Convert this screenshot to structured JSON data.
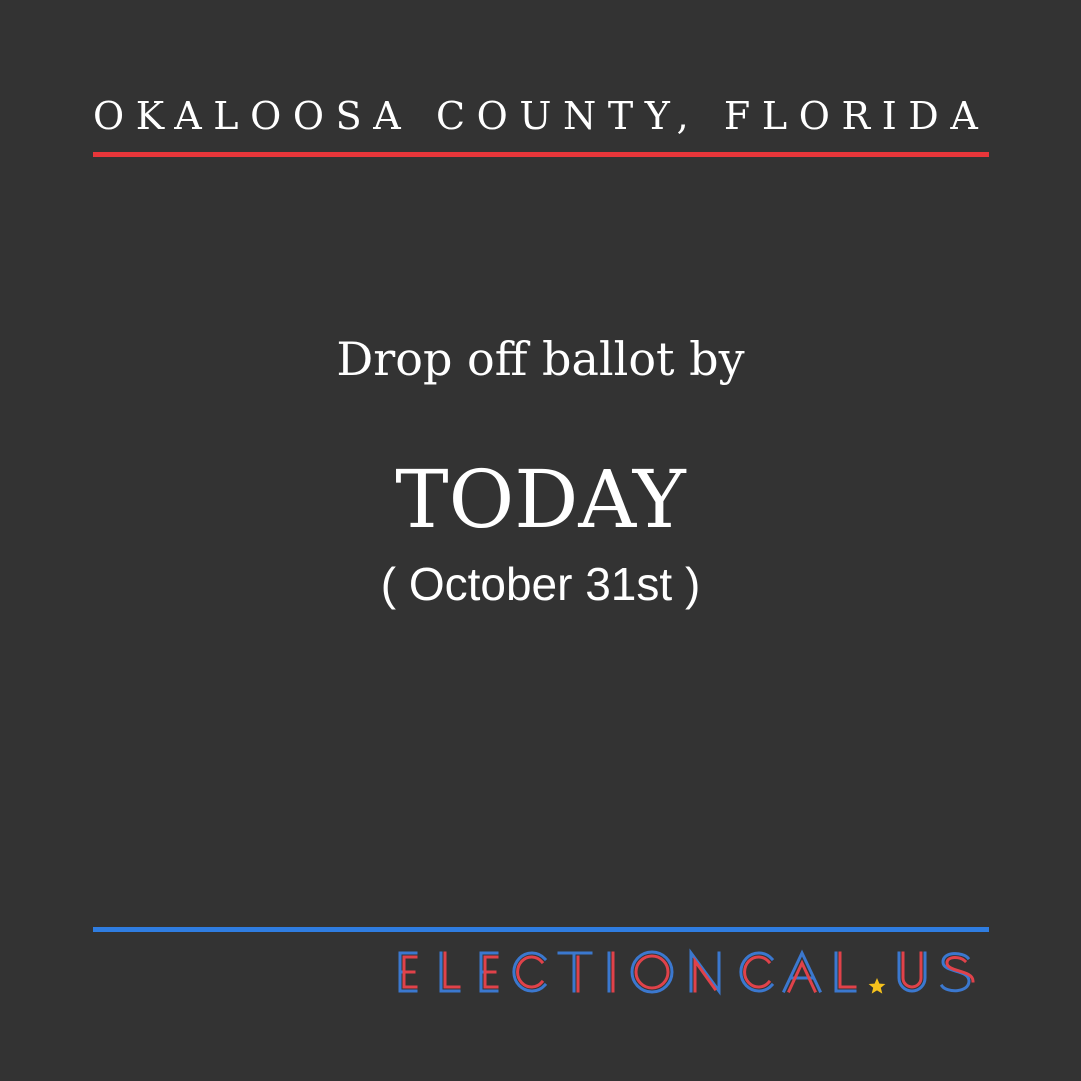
{
  "header": {
    "county": "OKALOOSA COUNTY, FLORIDA"
  },
  "message": {
    "lead": "Drop off ballot by",
    "deadline": "TODAY",
    "date": "( October 31st )"
  },
  "brand": {
    "logo_text": "ELECTIONCAL.US"
  },
  "colors": {
    "background": "#333333",
    "text": "#ffffff",
    "accent_red": "#e8363a",
    "accent_blue": "#2f7de1",
    "star": "#f6c21c"
  }
}
